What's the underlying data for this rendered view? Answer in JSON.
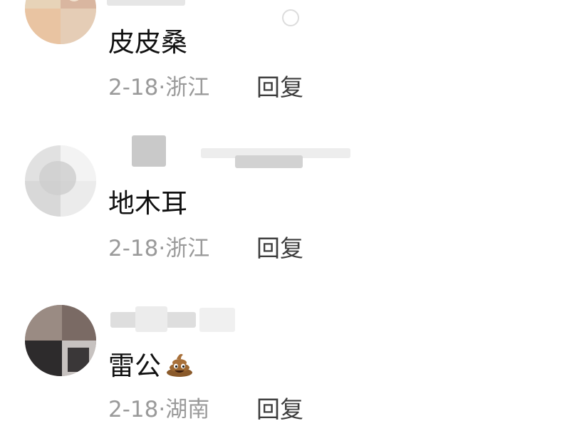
{
  "comments": [
    {
      "text": "皮皮桑",
      "date": "2-18",
      "separator": "·",
      "location": "浙江",
      "reply_label": "回复"
    },
    {
      "text": "地木耳",
      "date": "2-18",
      "separator": "·",
      "location": "浙江",
      "reply_label": "回复"
    },
    {
      "text": "雷公",
      "emoji": "poop-emoji",
      "date": "2-18",
      "separator": "·",
      "location": "湖南",
      "reply_label": "回复"
    }
  ],
  "colors": {
    "comment_text": "#111111",
    "meta_text": "#9a9a9a",
    "reply_text": "#3d3d3d",
    "background": "#ffffff"
  }
}
